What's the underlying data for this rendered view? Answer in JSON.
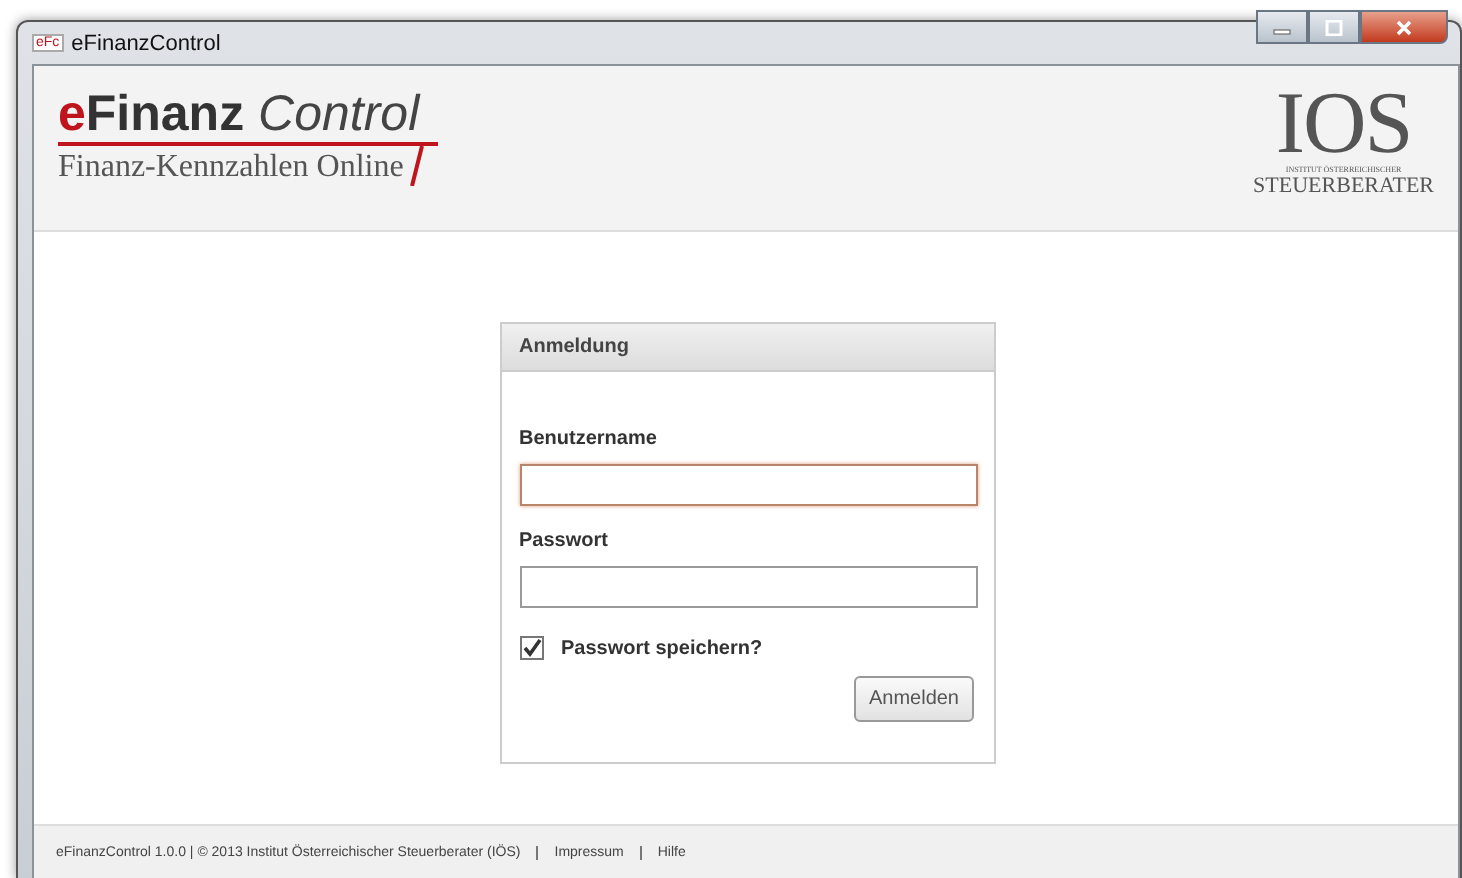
{
  "window": {
    "title": "eFinanzControl",
    "icon_text": "eFc"
  },
  "header": {
    "logo": {
      "accent": "e",
      "bold": "Finanz",
      "italic": "Control",
      "subtitle": "Finanz-Kennzahlen Online"
    },
    "brand": {
      "letters": "IOS",
      "line_1": "INSTITUT ÖSTERREICHISCHER",
      "line_2": "STEUERBERATER"
    }
  },
  "login": {
    "title": "Anmeldung",
    "fields": [
      {
        "label": "Benutzername",
        "focused": true
      },
      {
        "label": "Passwort",
        "focused": false
      }
    ],
    "remember": {
      "label": "Passwort speichern?",
      "checked": true
    },
    "button": "Anmelden"
  },
  "footer": {
    "text": "eFinanzControl 1.0.0 | © 2013 Institut Österreichischer Steuerberater (IÖS)",
    "links": [
      "Impressum",
      "Hilfe"
    ]
  }
}
